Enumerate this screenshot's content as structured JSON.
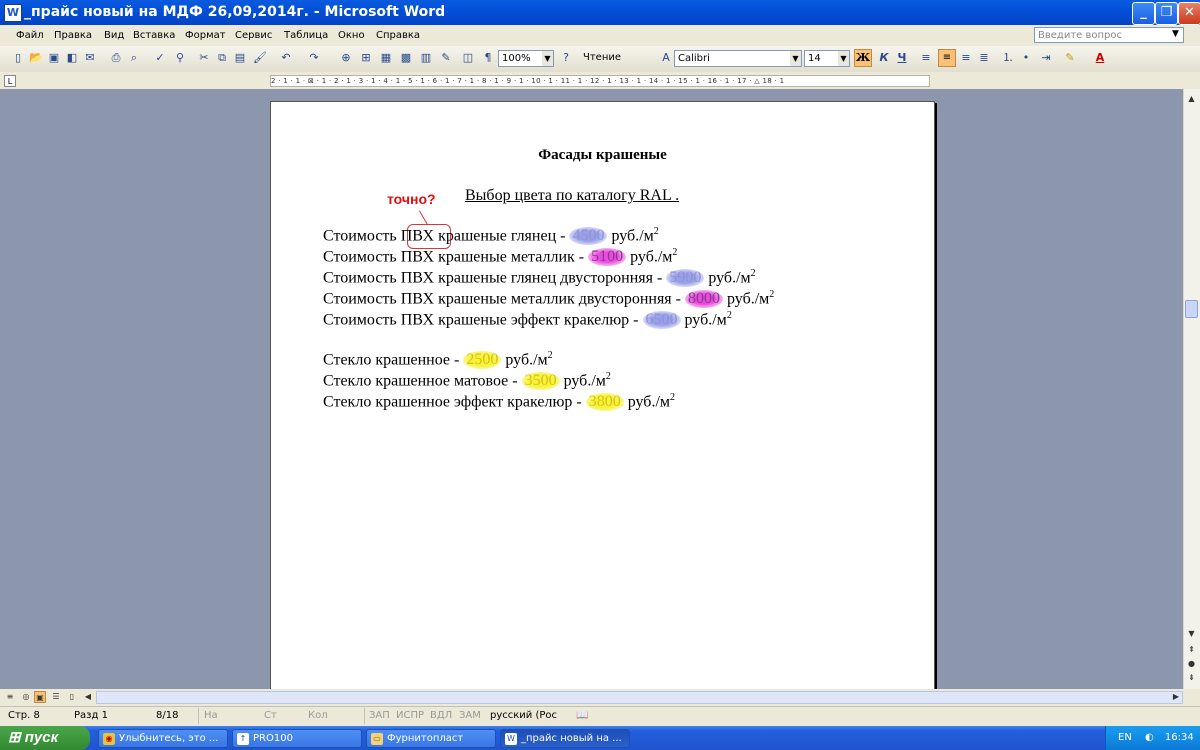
{
  "window": {
    "title": "_прайс новый на МДФ 26,09,2014г. - Microsoft Word",
    "minimize": "_",
    "restore": "❐",
    "close": "✕"
  },
  "menu": {
    "items": [
      "Файл",
      "Правка",
      "Вид",
      "Вставка",
      "Формат",
      "Сервис",
      "Таблица",
      "Окно",
      "Справка"
    ],
    "ask_placeholder": "Введите вопрос"
  },
  "toolbar": {
    "zoom": "100%",
    "reading": "Чтение",
    "font": "Calibri",
    "font_size": "14",
    "bold": "Ж",
    "italic": "К",
    "underline": "Ч"
  },
  "ruler": {
    "marks": "2 · 1 · 1 · ⊠ · 1 · 2 · 1 · 3 · 1 · 4 · 1 · 5 · 1 · 6 · 1 · 7 · 1 · 8 · 1 · 9 · 1 · 10 · 1 · 11 · 1 · 12 · 1 · 13 · 1 · 14 · 1 · 15 · 1 · 16 · 1 · 17 · △ 18 · 1"
  },
  "document": {
    "title": "Фасады крашеные",
    "subtitle": "Выбор цвета по каталогу RAL .",
    "note": "точно?",
    "pvc_lines": [
      {
        "pre": "Стоимость ",
        "hl": "ПВХ",
        "mid": " крашеные глянец  - ",
        "price": "4500",
        "unit": " руб./м",
        "color": "blue"
      },
      {
        "pre": "Стоимость ",
        "hl": "ПВХ",
        "mid": " крашеные металлик - ",
        "price": "5100",
        "unit": " руб./м",
        "color": "pink"
      },
      {
        "pre": "Стоимость ",
        "hl": "ПВХ",
        "mid": " крашеные глянец двусторонняя - ",
        "price": "5900",
        "unit": " руб./м",
        "color": "blue"
      },
      {
        "pre": "Стоимость ",
        "hl": "ПВХ",
        "mid": " крашеные металлик двусторонняя - ",
        "price": "8000",
        "unit": " руб./м",
        "color": "pink"
      },
      {
        "pre": "Стоимость ",
        "hl": "ПВХ",
        "mid": " крашеные эффект кракелюр - ",
        "price": "6500",
        "unit": " руб./м",
        "color": "blue"
      }
    ],
    "glass_lines": [
      {
        "pre": "Стекло крашенное - ",
        "price": "2500",
        "unit": " руб./м",
        "color": "yellow"
      },
      {
        "pre": "Стекло крашенное матовое  - ",
        "price": "3500",
        "unit": " руб./м",
        "color": "yellow"
      },
      {
        "pre": "Стекло крашенное эффект кракелюр  - ",
        "price": "3800",
        "unit": " руб./м",
        "color": "yellow"
      }
    ],
    "superscript": "2"
  },
  "status": {
    "page": "Стр. 8",
    "section": "Разд 1",
    "pages": "8/18",
    "at": "На",
    "line": "Ст",
    "col": "Кол",
    "rec": "ЗАП",
    "trk": "ИСПР",
    "ext": "ВДЛ",
    "ovr": "ЗАМ",
    "language": "русский (Рос"
  },
  "taskbar": {
    "start": "пуск",
    "tasks": [
      "Улыбнитесь, это ...",
      "PRO100",
      "Фурнитопласт",
      "_прайс новый на ..."
    ],
    "lang": "EN",
    "clock": "16:34"
  }
}
